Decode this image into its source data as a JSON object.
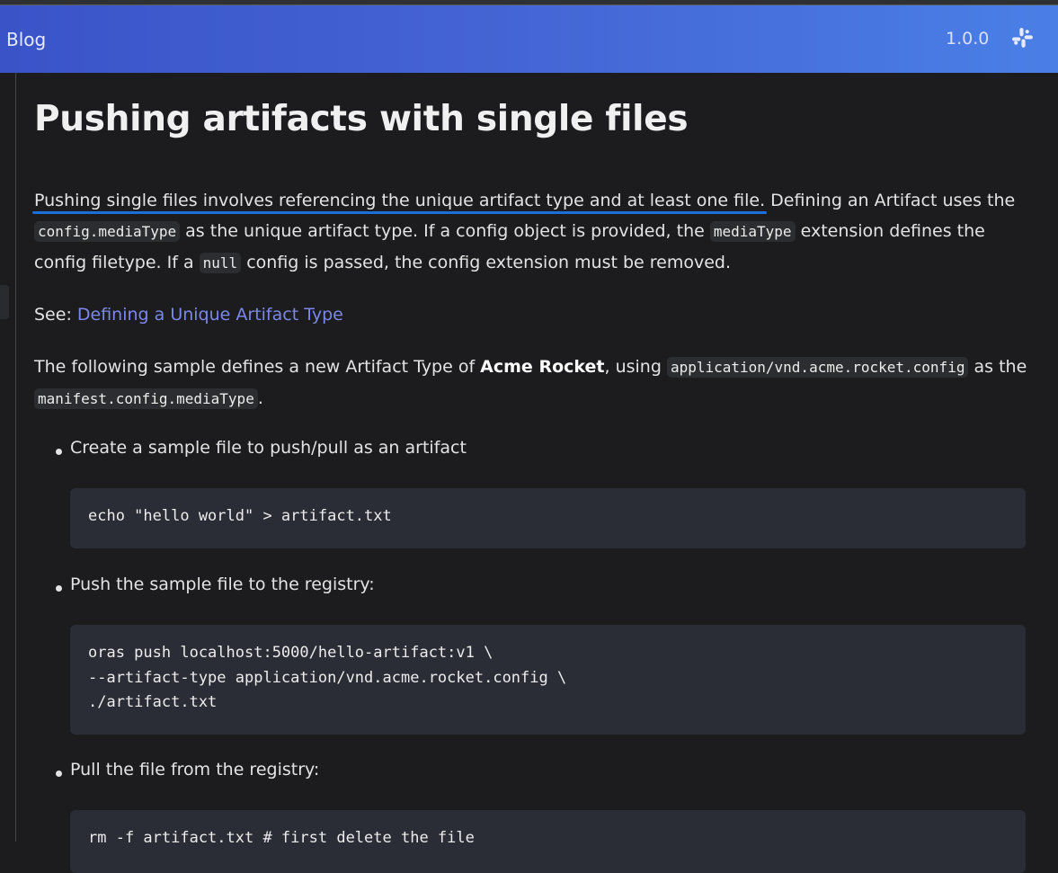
{
  "navbar": {
    "blog_label": "Blog",
    "version": "1.0.0",
    "slack_icon": "slack-icon",
    "gradient": [
      "#3a54c8",
      "#4a7fe6"
    ]
  },
  "page": {
    "title": "Pushing artifacts with single files",
    "intro": {
      "underlined": "Pushing single files involves referencing the unique artifact type and at least one file.",
      "after_underline": " Defining an Artifact uses the ",
      "code1": "config.mediaType",
      "text2": " as the unique artifact type. If a config object is provided, the ",
      "code2": "mediaType",
      "text3": " extension defines the config filetype. If a ",
      "code3": "null",
      "text4": " config is passed, the config extension must be removed."
    },
    "see": {
      "label": "See: ",
      "link": "Defining a Unique Artifact Type"
    },
    "sample": {
      "text1": "The following sample defines a new Artifact Type of ",
      "bold": "Acme Rocket",
      "text2": ", using ",
      "code1": "application/vnd.acme.rocket.config",
      "text3": " as the ",
      "code2": "manifest.config.mediaType",
      "text4": "."
    },
    "steps": [
      {
        "label": "Create a sample file to push/pull as an artifact",
        "code": "echo \"hello world\" > artifact.txt"
      },
      {
        "label": "Push the sample file to the registry:",
        "code": "oras push localhost:5000/hello-artifact:v1 \\\n--artifact-type application/vnd.acme.rocket.config \\\n./artifact.txt"
      },
      {
        "label": "Pull the file from the registry:",
        "code": "rm -f artifact.txt # first delete the file"
      }
    ]
  },
  "colors": {
    "background": "#1c1c1e",
    "link": "#7a88e8",
    "underline": "#1a6fd8",
    "code_bg": "#2b2d36"
  }
}
